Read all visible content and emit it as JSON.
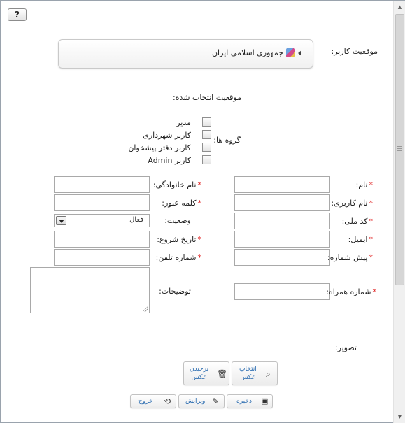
{
  "help_label": "?",
  "location": {
    "label": "موقعیت کاربر:",
    "current": "جمهوری اسلامی ایران",
    "selected_label": "موقعیت انتخاب شده:"
  },
  "groups": {
    "label": "گروه ها:",
    "options": [
      "مدیر",
      "کاربر شهرداری",
      "کاربر دفتر پیشخوان",
      "کاربر Admin"
    ]
  },
  "right_fields": {
    "first_name": "نام:",
    "username": "نام کاربری:",
    "national_code": "کد ملی:",
    "email": "ایمیل:",
    "prefix": "پیش شماره:",
    "mobile": "شماره همراه:"
  },
  "left_fields": {
    "last_name": "نام خانوادگی:",
    "password": "کلمه عبور:",
    "status": "وضعیت:",
    "status_value": "فعال",
    "start_date": "تاریخ شروع:",
    "phone": "شماره تلفن:",
    "description": "توضیحات:"
  },
  "image": {
    "label": "تصویر:",
    "select_line1": "انتخاب",
    "select_line2": "عکس",
    "remove_line1": "برچیدن",
    "remove_line2": "عکس"
  },
  "actions": {
    "save": "ذخیره",
    "edit": "ویرایش",
    "exit": "خروج"
  },
  "required_mark": "*"
}
